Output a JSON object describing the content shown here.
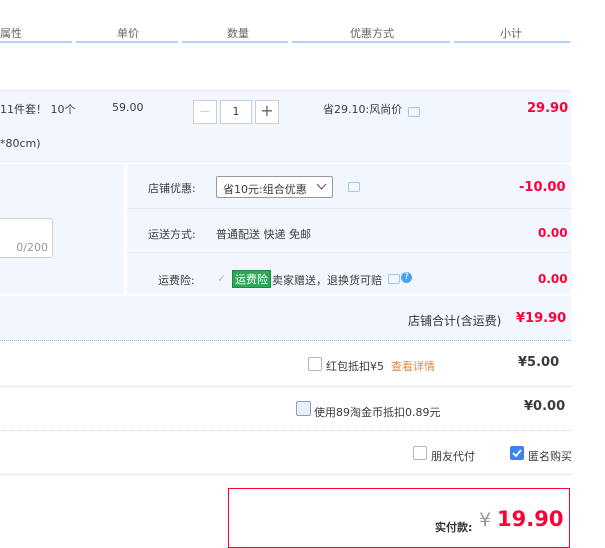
{
  "header": {
    "col_attr": "属性",
    "col_unit_price": "单价",
    "col_quantity": "数量",
    "col_discount": "优惠方式",
    "col_subtotal": "小计"
  },
  "item": {
    "title_fragment": "11件套！ 10个",
    "spec_fragment": "*80cm)",
    "unit_price": "59.00",
    "qty_minus": "—",
    "qty_value": "1",
    "qty_plus": "+",
    "discount": "省29.10:风尚价",
    "subtotal": "29.90"
  },
  "message": {
    "counter": "0/200"
  },
  "shop": {
    "promo_label": "店铺优惠:",
    "promo_value": "省10元:组合优惠",
    "promo_amount": "-10.00",
    "shipping_label": "运送方式:",
    "shipping_value": "普通配送 快递 免邮",
    "shipping_amount": "0.00",
    "insurance_label": "运费险:",
    "insurance_badge": "运费险",
    "insurance_text": "卖家赠送，退换货可赔",
    "insurance_amount": "0.00",
    "total_label": "店铺合计(含运费)",
    "total_value": "¥19.90"
  },
  "payment": {
    "redpacket_label": "红包抵扣¥5",
    "redpacket_link": "查看详情",
    "redpacket_amount": "¥5.00",
    "taojinbi_label": "使用89淘金币抵扣0.89元",
    "taojinbi_amount": "¥0.00",
    "friend_pay_label": "朋友代付",
    "anonymous_label": "匿名购买"
  },
  "summary": {
    "label": "实付款:",
    "currency": "¥",
    "amount": "19.90"
  },
  "colors": {
    "price_red": "#ff0036",
    "accent_blue": "#3c82f5",
    "row_blue_bg": "#f2f7ff",
    "insurance_green": "#2da855"
  }
}
